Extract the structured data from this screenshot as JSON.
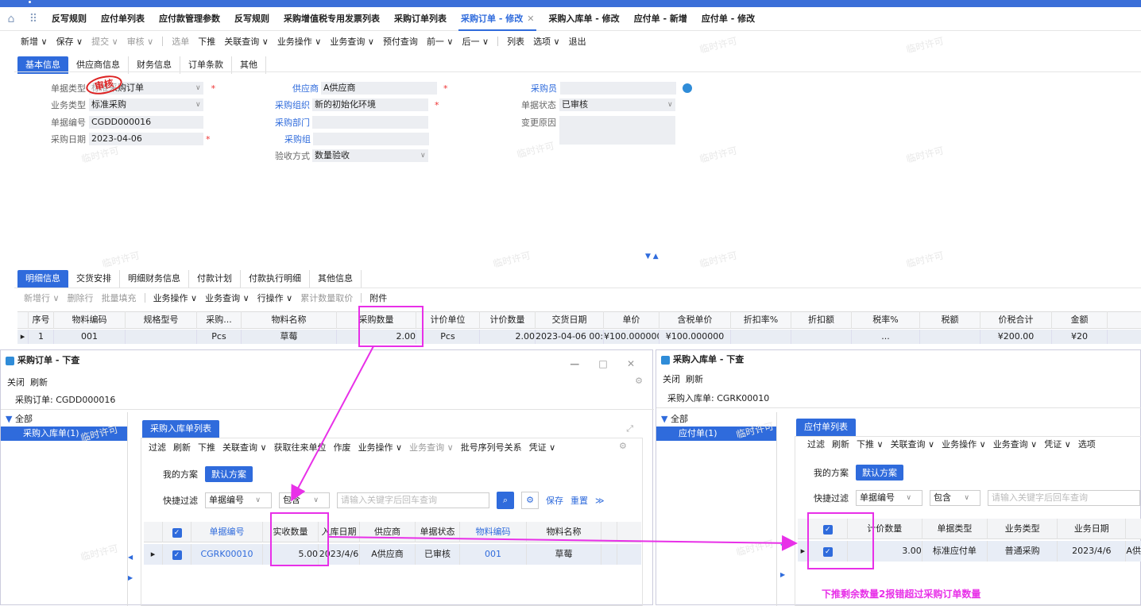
{
  "tabs": [
    "反写规则",
    "应付单列表",
    "应付款管理参数",
    "反写规则",
    "采购增值税专用发票列表",
    "采购订单列表",
    "采购订单 - 修改",
    "采购入库单 - 修改",
    "应付单 - 新增",
    "应付单 - 修改"
  ],
  "active_tab_index": 6,
  "toolbar": {
    "items": [
      "新增 ∨",
      "保存 ∨",
      "提交 ∨",
      "审核 ∨",
      "选单",
      "下推",
      "关联查询 ∨",
      "业务操作 ∨",
      "业务查询 ∨",
      "预付查询",
      "前一 ∨",
      "后一 ∨",
      "列表",
      "选项 ∨",
      "退出"
    ],
    "disabled": [
      2,
      3,
      4
    ]
  },
  "section_tabs": [
    "基本信息",
    "供应商信息",
    "财务信息",
    "订单条款",
    "其他"
  ],
  "form": {
    "doc_type_label": "单据类型",
    "doc_type_value": "标准采购订单",
    "biz_type_label": "业务类型",
    "biz_type_value": "标准采购",
    "doc_no_label": "单据编号",
    "doc_no_value": "CGDD000016",
    "date_label": "采购日期",
    "date_value": "2023-04-06",
    "supplier_label": "供应商",
    "supplier_value": "A供应商",
    "org_label": "采购组织",
    "org_value": "新的初始化环境",
    "dept_label": "采购部门",
    "dept_value": "",
    "group_label": "采购组",
    "group_value": "",
    "accept_label": "验收方式",
    "accept_value": "数量验收",
    "buyer_label": "采购员",
    "buyer_value": "",
    "status_label": "单据状态",
    "status_value": "已审核",
    "change_label": "变更原因",
    "change_value": ""
  },
  "stamp_text": "审核",
  "watermark": "临时许可",
  "detail_tabs": [
    "明细信息",
    "交货安排",
    "明细财务信息",
    "付款计划",
    "付款执行明细",
    "其他信息"
  ],
  "detail_toolbar": [
    "新增行 ∨",
    "删除行",
    "批量填充",
    "业务操作 ∨",
    "业务查询 ∨",
    "行操作 ∨",
    "累计数量取价",
    "附件"
  ],
  "detail_headers": [
    "序号",
    "物料编码",
    "规格型号",
    "采购...",
    "物料名称",
    "采购数量",
    "计价单位",
    "计价数量",
    "交货日期",
    "单价",
    "含税单价",
    "折扣率%",
    "折扣额",
    "税率%",
    "税额",
    "价税合计",
    "金额"
  ],
  "detail_row": [
    "1",
    "001",
    "",
    "Pcs",
    "草莓",
    "2.00",
    "Pcs",
    "2.00",
    "2023-04-06 00:",
    "¥100.000000",
    "¥100.000000",
    "",
    "",
    "...",
    "",
    "¥200.00",
    "¥20"
  ],
  "left_panel": {
    "title": "采购订单 - 下查",
    "tools": [
      "关闭",
      "刷新"
    ],
    "doc_line": "采购订单: CGDD000016",
    "tree_all": "全部",
    "tree_item": "采购入库单(1)",
    "subtab": "采购入库单列表",
    "bar": [
      "过滤",
      "刷新",
      "下推",
      "关联查询 ∨",
      "获取往来单位",
      "作废",
      "业务操作 ∨",
      "业务查询 ∨",
      "批号序列号关系",
      "凭证 ∨"
    ],
    "scheme_label": "我的方案",
    "scheme_btn": "默认方案",
    "filter_label": "快捷过滤",
    "filter_field": "单据编号",
    "filter_op": "包含",
    "filter_placeholder": "请输入关键字后回车查询",
    "save": "保存",
    "reset": "重置",
    "headers": [
      "单据编号",
      "实收数量",
      "入库日期",
      "供应商",
      "单据状态",
      "物料编码",
      "物料名称"
    ],
    "row": [
      "CGRK00010",
      "5.00",
      "2023/4/6",
      "A供应商",
      "已审核",
      "001",
      "草莓"
    ]
  },
  "right_panel": {
    "title": "采购入库单 - 下查",
    "tools": [
      "关闭",
      "刷新"
    ],
    "doc_line": "采购入库单: CGRK00010",
    "tree_all": "全部",
    "tree_item": "应付单(1)",
    "subtab": "应付单列表",
    "bar": [
      "过滤",
      "刷新",
      "下推 ∨",
      "关联查询 ∨",
      "业务操作 ∨",
      "业务查询 ∨",
      "凭证 ∨",
      "选项"
    ],
    "scheme_label": "我的方案",
    "scheme_btn": "默认方案",
    "filter_label": "快捷过滤",
    "filter_field": "单据编号",
    "filter_op": "包含",
    "filter_placeholder": "请输入关键字后回车查询",
    "headers": [
      "计价数量",
      "单据类型",
      "业务类型",
      "业务日期"
    ],
    "row": [
      "3.00",
      "标准应付单",
      "普通采购",
      "2023/4/6",
      "A供"
    ]
  },
  "note": "下推剩余数量2报错超过采购订单数量",
  "colors": {
    "accent": "#2f6bdc",
    "highlight": "#e830e8",
    "required": "#e33"
  }
}
